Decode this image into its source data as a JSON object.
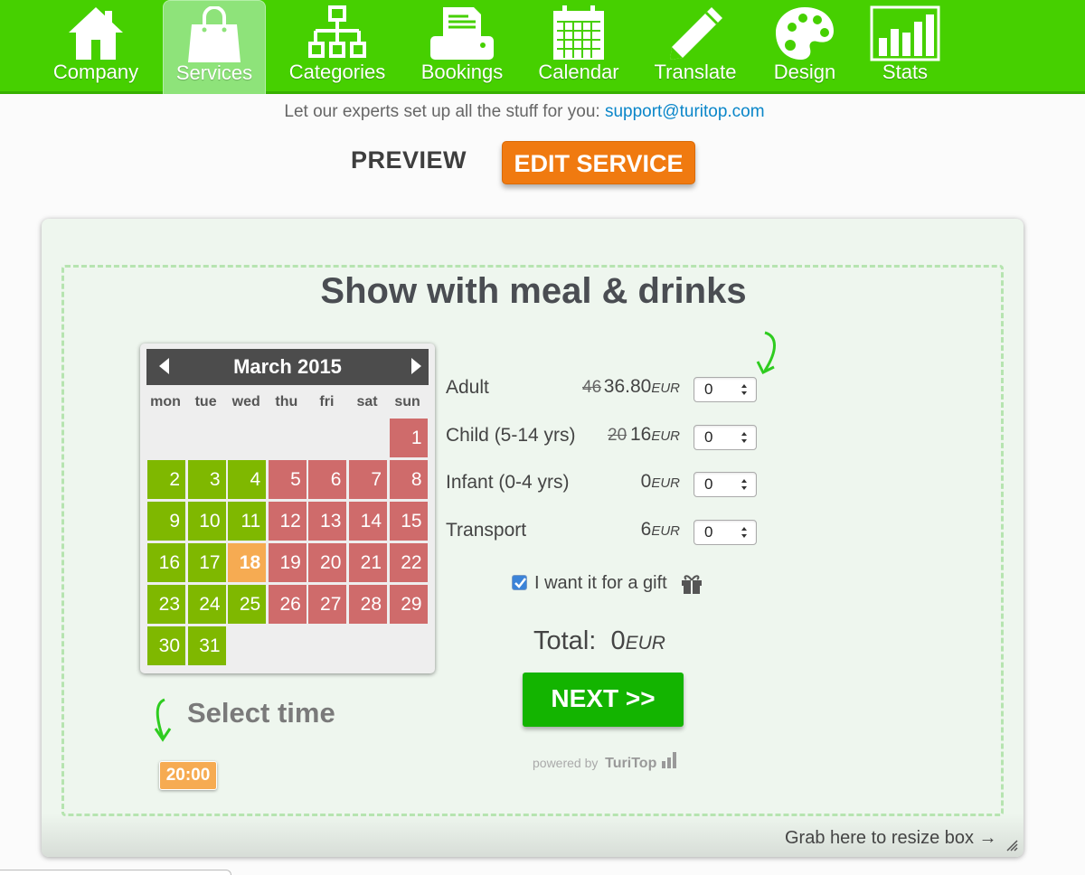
{
  "nav": {
    "items": [
      {
        "label": "Company",
        "icon": "house-icon",
        "active": false
      },
      {
        "label": "Services",
        "icon": "shopping-bag-icon",
        "active": true
      },
      {
        "label": "Categories",
        "icon": "hierarchy-icon",
        "active": false
      },
      {
        "label": "Bookings",
        "icon": "printer-icon",
        "active": false
      },
      {
        "label": "Calendar",
        "icon": "calendar-icon",
        "active": false
      },
      {
        "label": "Translate",
        "icon": "pencil-icon",
        "active": false
      },
      {
        "label": "Design",
        "icon": "palette-icon",
        "active": false
      },
      {
        "label": "Stats",
        "icon": "bar-chart-icon",
        "active": false
      }
    ]
  },
  "support": {
    "text": "Let our experts set up all the stuff for you: ",
    "email": "support@turitop.com"
  },
  "header": {
    "preview_label": "PREVIEW",
    "edit_label": "EDIT SERVICE"
  },
  "service": {
    "title": "Show with meal & drinks"
  },
  "calendar": {
    "month_label": "March 2015",
    "weekdays": [
      "mon",
      "tue",
      "wed",
      "thu",
      "fri",
      "sat",
      "sun"
    ],
    "selected_day": 18,
    "days": [
      {
        "d": "1",
        "status": "closed"
      },
      {
        "d": "2",
        "status": "open"
      },
      {
        "d": "3",
        "status": "open"
      },
      {
        "d": "4",
        "status": "open"
      },
      {
        "d": "5",
        "status": "closed"
      },
      {
        "d": "6",
        "status": "closed"
      },
      {
        "d": "7",
        "status": "closed"
      },
      {
        "d": "8",
        "status": "closed"
      },
      {
        "d": "9",
        "status": "open"
      },
      {
        "d": "10",
        "status": "open"
      },
      {
        "d": "11",
        "status": "open"
      },
      {
        "d": "12",
        "status": "closed"
      },
      {
        "d": "13",
        "status": "closed"
      },
      {
        "d": "14",
        "status": "closed"
      },
      {
        "d": "15",
        "status": "closed"
      },
      {
        "d": "16",
        "status": "open"
      },
      {
        "d": "17",
        "status": "open"
      },
      {
        "d": "18",
        "status": "selected"
      },
      {
        "d": "19",
        "status": "closed"
      },
      {
        "d": "20",
        "status": "closed"
      },
      {
        "d": "21",
        "status": "closed"
      },
      {
        "d": "22",
        "status": "closed"
      },
      {
        "d": "23",
        "status": "open"
      },
      {
        "d": "24",
        "status": "open"
      },
      {
        "d": "25",
        "status": "open"
      },
      {
        "d": "26",
        "status": "closed"
      },
      {
        "d": "27",
        "status": "closed"
      },
      {
        "d": "28",
        "status": "closed"
      },
      {
        "d": "29",
        "status": "closed"
      },
      {
        "d": "30",
        "status": "open"
      },
      {
        "d": "31",
        "status": "open"
      }
    ]
  },
  "time": {
    "label": "Select time",
    "slots": [
      "20:00"
    ]
  },
  "prices": [
    {
      "label": "Adult",
      "old": "46",
      "price": "36.80",
      "currency": "EUR",
      "qty": "0"
    },
    {
      "label": "Child (5-14 yrs)",
      "old": "20",
      "price": "16",
      "currency": "EUR",
      "qty": "0"
    },
    {
      "label": "Infant (0-4 yrs)",
      "old": "",
      "price": "0",
      "currency": "EUR",
      "qty": "0"
    },
    {
      "label": "Transport",
      "old": "",
      "price": "6",
      "currency": "EUR",
      "qty": "0"
    }
  ],
  "gift": {
    "label": "I want it for a gift",
    "checked": true
  },
  "total": {
    "label": "Total:",
    "value": "0",
    "currency": "EUR"
  },
  "next_label": "NEXT >>",
  "powered": {
    "prefix": "powered by",
    "brand": "TuriTop"
  },
  "resize_label": "Grab here to resize box →",
  "colors": {
    "nav_green": "#46d000",
    "open_day": "#7fb800",
    "closed_day": "#cf6b6b",
    "selected_day": "#f6ab52",
    "edit_orange": "#f07a10",
    "next_green": "#13b400"
  }
}
